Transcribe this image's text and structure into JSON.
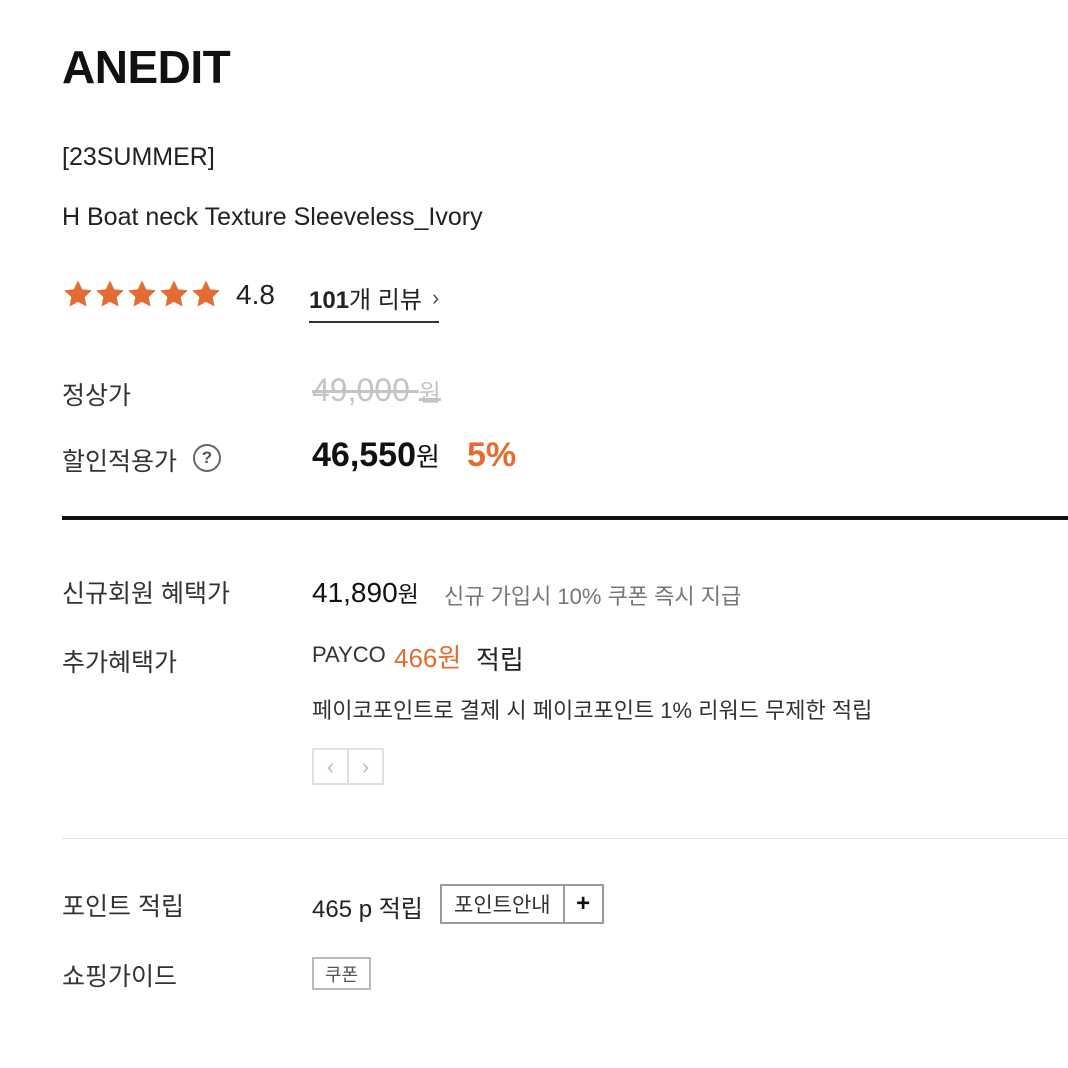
{
  "product": {
    "brand": "ANEDIT",
    "season": "[23SUMMER]",
    "name": "H Boat neck Texture Sleeveless_Ivory"
  },
  "rating": {
    "stars": 5,
    "score": "4.8",
    "review_count": "101",
    "review_suffix": "개 리뷰",
    "chevron": "›"
  },
  "pricing": {
    "regular_label": "정상가",
    "regular_price": "49,000",
    "regular_unit": "원",
    "sale_label": "할인적용가",
    "help_icon_text": "?",
    "sale_price": "46,550",
    "sale_unit": "원",
    "discount": "5%"
  },
  "benefits": {
    "member_label": "신규회원 혜택가",
    "member_price": "41,890",
    "member_unit": "원",
    "member_note": "신규 가입시 10% 쿠폰 즉시 지급",
    "extra_label": "추가혜택가",
    "payco_name": "PAYCO",
    "payco_amount": "466원",
    "payco_accum": "적립",
    "payco_desc": "페이코포인트로 결제 시 페이코포인트 1% 리워드 무제한 적립",
    "prev_icon": "‹",
    "next_icon": "›"
  },
  "points": {
    "label": "포인트 적립",
    "value": "465 p 적립",
    "guide_button": "포인트안내",
    "plus_icon": "+"
  },
  "shopping": {
    "label": "쇼핑가이드",
    "coupon_button": "쿠폰"
  },
  "colors": {
    "accent": "#e46c2f",
    "strike": "#c4c4c4",
    "divider": "#111111"
  }
}
